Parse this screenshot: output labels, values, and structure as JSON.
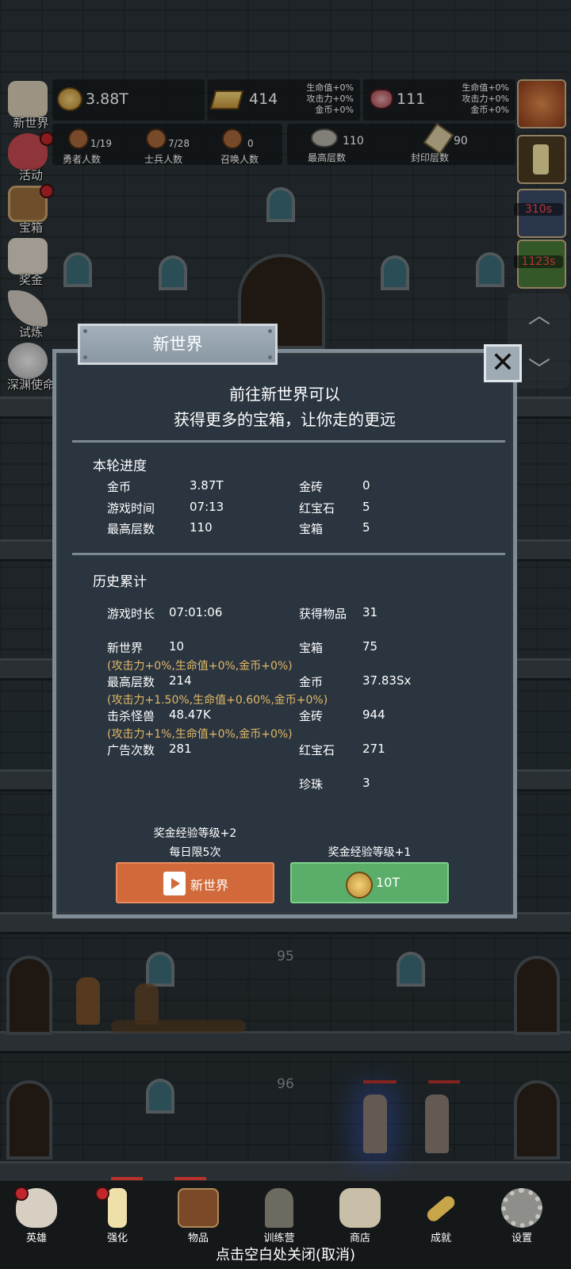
{
  "top_bar": {
    "gold": "3.88T",
    "gold_bar": "414",
    "gold_bar_bonus": [
      "生命值+0%",
      "攻击力+0%",
      "金币+0%"
    ],
    "ruby": "111",
    "ruby_bonus": [
      "生命值+0%",
      "攻击力+0%",
      "金币+0%"
    ]
  },
  "counts": {
    "hero_count_value": "1/19",
    "hero_count_label": "勇者人数",
    "soldier_count_value": "7/28",
    "soldier_count_label": "士兵人数",
    "summon_count_value": "0",
    "summon_count_label": "召唤人数",
    "max_floor_value": "110",
    "max_floor_label": "最高层数",
    "sealed_floor_value": "90",
    "sealed_floor_label": "封印层数"
  },
  "side_menu": [
    {
      "label": "新世界",
      "icon": "scroll-map-icon"
    },
    {
      "label": "活动",
      "icon": "heart-icon"
    },
    {
      "label": "宝箱",
      "icon": "treasure-chest-icon"
    },
    {
      "label": "奖金",
      "icon": "envelope-icon"
    },
    {
      "label": "试炼",
      "icon": "feather-icon"
    },
    {
      "label": "深渊使命",
      "icon": "pearl-icon"
    }
  ],
  "right_timers": {
    "timer1": "310s",
    "timer2": "1123s"
  },
  "dialog": {
    "title": "新世界",
    "intro_line1": "前往新世界可以",
    "intro_line2": "获得更多的宝箱，让你走的更远",
    "round_progress_title": "本轮进度",
    "round": {
      "gold_label": "金币",
      "gold_value": "3.87T",
      "gold_bar_label": "金砖",
      "gold_bar_value": "0",
      "play_time_label": "游戏时间",
      "play_time_value": "07:13",
      "ruby_label": "红宝石",
      "ruby_value": "5",
      "max_floor_label": "最高层数",
      "max_floor_value": "110",
      "chest_label": "宝箱",
      "chest_value": "5"
    },
    "history_title": "历史累计",
    "history": {
      "duration_label": "游戏时长",
      "duration_value": "07:01:06",
      "items_label": "获得物品",
      "items_value": "31",
      "new_world_label": "新世界",
      "new_world_value": "10",
      "chest_label": "宝箱",
      "chest_value": "75",
      "new_world_bonus": "(攻击力+0%,生命值+0%,金币+0%)",
      "max_floor_label": "最高层数",
      "max_floor_value": "214",
      "gold_label": "金币",
      "gold_value": "37.83Sx",
      "max_floor_bonus": "(攻击力+1.50%,生命值+0.60%,金币+0%)",
      "kills_label": "击杀怪兽",
      "kills_value": "48.47K",
      "gold_bar_label": "金砖",
      "gold_bar_value": "944",
      "kills_bonus": "(攻击力+1%,生命值+0%,金币+0%)",
      "ads_label": "广告次数",
      "ads_value": "281",
      "ruby_label": "红宝石",
      "ruby_value": "271",
      "pearl_label": "珍珠",
      "pearl_value": "3"
    },
    "left_note_line1": "奖金经验等级+2",
    "left_note_line2": "每日限5次",
    "right_note": "奖金经验等级+1",
    "ad_button_label": "新世界",
    "coin_button_label": "10T"
  },
  "floors": {
    "floor_a": "95",
    "floor_b": "96"
  },
  "bottom_nav": [
    {
      "label": "英雄",
      "icon": "skull-icon"
    },
    {
      "label": "强化",
      "icon": "candle-icon"
    },
    {
      "label": "物品",
      "icon": "book-icon"
    },
    {
      "label": "训练营",
      "icon": "lantern-icon"
    },
    {
      "label": "商店",
      "icon": "mug-icon"
    },
    {
      "label": "成就",
      "icon": "key-icon"
    },
    {
      "label": "设置",
      "icon": "gear-icon"
    }
  ],
  "close_hint": "点击空白处关闭(取消)"
}
